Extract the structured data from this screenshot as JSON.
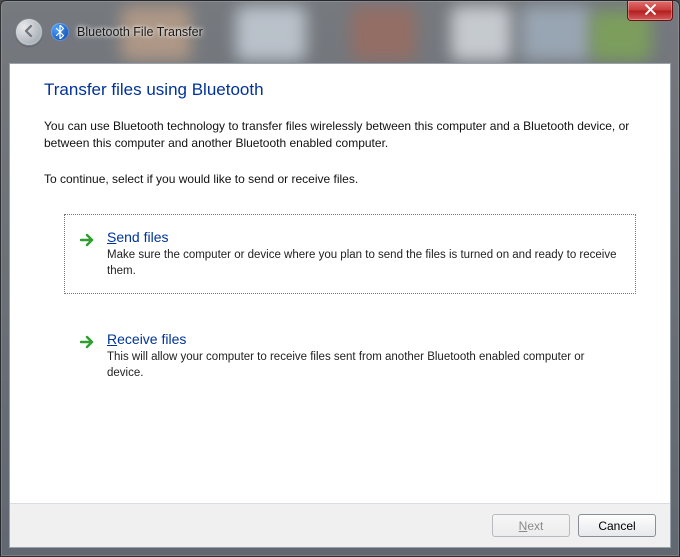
{
  "window": {
    "title": "Bluetooth File Transfer"
  },
  "page": {
    "heading": "Transfer files using Bluetooth",
    "intro": "You can use Bluetooth technology to transfer files wirelessly between this computer and a Bluetooth device, or between this computer and another Bluetooth enabled computer.",
    "prompt": "To continue, select if you would like to send or receive files."
  },
  "options": [
    {
      "id": "send",
      "title_pre": "S",
      "title_rest": "end files",
      "desc": "Make sure the computer or device where you plan to send the files is turned on and ready to receive them.",
      "selected": true
    },
    {
      "id": "receive",
      "title_pre": "R",
      "title_rest": "eceive files",
      "desc": "This will allow your computer to receive files sent from another Bluetooth enabled computer or device.",
      "selected": false
    }
  ],
  "footer": {
    "next_pre": "N",
    "next_rest": "ext",
    "next_enabled": false,
    "cancel": "Cancel"
  }
}
